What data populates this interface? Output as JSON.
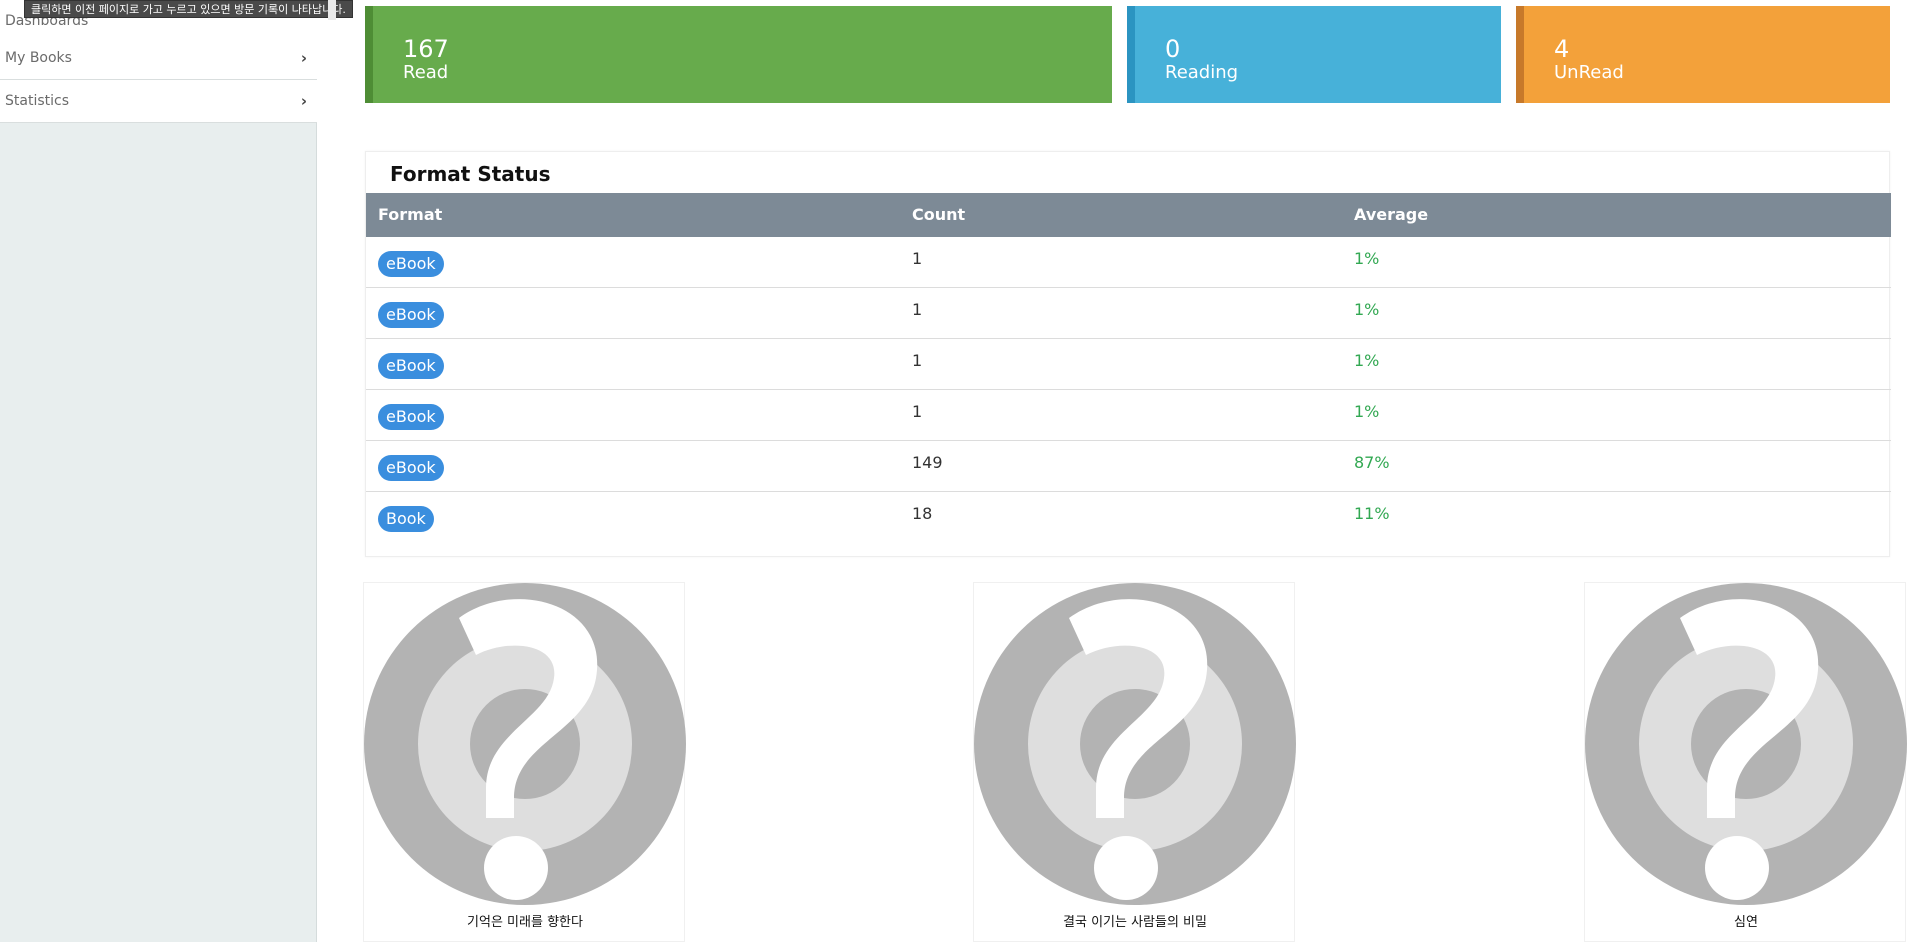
{
  "sidebar": {
    "items": [
      {
        "label": "Dashboards"
      },
      {
        "label": "My Books"
      },
      {
        "label": "Statistics"
      }
    ],
    "tooltip": "클릭하면 이전 페이지로 가고 누르고 있으면 방문 기록이 나타납니다."
  },
  "stats": {
    "read": {
      "count": "167",
      "label": "Read",
      "color": "#67ab4c"
    },
    "reading": {
      "count": "0",
      "label": "Reading",
      "color": "#47b1d9"
    },
    "unread": {
      "count": "4",
      "label": "UnRead",
      "color": "#f3a13a"
    }
  },
  "format_status": {
    "title": "Format Status",
    "columns": [
      "Format",
      "Count",
      "Average"
    ],
    "rows": [
      {
        "format": "eBook",
        "count": "1",
        "average": "1%"
      },
      {
        "format": "eBook",
        "count": "1",
        "average": "1%"
      },
      {
        "format": "eBook",
        "count": "1",
        "average": "1%"
      },
      {
        "format": "eBook",
        "count": "1",
        "average": "1%"
      },
      {
        "format": "eBook",
        "count": "149",
        "average": "87%"
      },
      {
        "format": "Book",
        "count": "18",
        "average": "11%"
      }
    ]
  },
  "books": [
    {
      "title": "기억은 미래를 향한다",
      "icon": "question-mark-placeholder-icon"
    },
    {
      "title": "결국 이기는 사람들의 비밀",
      "icon": "question-mark-placeholder-icon"
    },
    {
      "title": "심연",
      "icon": "question-mark-placeholder-icon"
    }
  ],
  "colors": {
    "accent_badge": "#3a8ede",
    "average_text": "#32a852",
    "table_header": "#7d8a96"
  }
}
